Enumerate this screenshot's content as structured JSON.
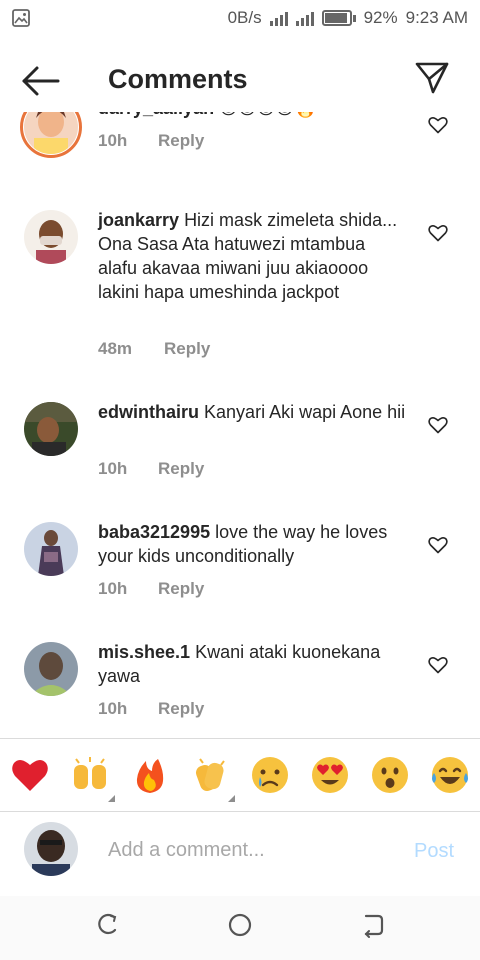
{
  "status_bar": {
    "data_rate": "0B/s",
    "battery": "92%",
    "battery_level": 0.92,
    "time": "9:23 AM"
  },
  "header": {
    "title": "Comments",
    "back_icon": "arrow-left-icon",
    "share_icon": "paper-plane-icon"
  },
  "comments": [
    {
      "username": "darry_aaliyah",
      "text": "",
      "emoji": "😍😍😍😍🔥",
      "time": "10h",
      "reply_label": "Reply",
      "avatar_colors": [
        "#f0b48a",
        "#fcd86b",
        "#f5d5c0"
      ]
    },
    {
      "username": "joankarry",
      "text": "Hizi mask zimeleta shida... Ona Sasa Ata hatuwezi mtambua alafu akavaa miwani juu akiaoooo lakini hapa umeshinda jackpot",
      "time": "48m",
      "reply_label": "Reply",
      "avatar_colors": [
        "#7a4b2e",
        "#e2d7cf",
        "#f4efe9"
      ]
    },
    {
      "username": "edwinthairu",
      "text": "Kanyari Aki wapi Aone hii",
      "time": "10h",
      "reply_label": "Reply",
      "avatar_colors": [
        "#3a4a2a",
        "#5b5b3f",
        "#2a2a2a"
      ]
    },
    {
      "username": "baba3212995",
      "text": "love the way he loves your kids unconditionally",
      "time": "10h",
      "reply_label": "Reply",
      "avatar_colors": [
        "#c9d3e3",
        "#4a3b58",
        "#8a6b86"
      ]
    },
    {
      "username": "mis.shee.1",
      "text": "Kwani ataki kuonekana yawa",
      "time": "10h",
      "reply_label": "Reply",
      "avatar_colors": [
        "#8c9aa8",
        "#a4c36b",
        "#5e4a3c"
      ]
    }
  ],
  "emoji_bar": [
    {
      "name": "red-heart-emoji",
      "glyph": "❤️"
    },
    {
      "name": "raising-hands-emoji",
      "glyph": "🙌"
    },
    {
      "name": "fire-emoji",
      "glyph": "🔥"
    },
    {
      "name": "clapping-hands-emoji",
      "glyph": "👏"
    },
    {
      "name": "crying-face-emoji",
      "glyph": "😢"
    },
    {
      "name": "heart-eyes-emoji",
      "glyph": "😍"
    },
    {
      "name": "surprised-face-emoji",
      "glyph": "😮"
    },
    {
      "name": "tears-of-joy-emoji",
      "glyph": "😂"
    }
  ],
  "composer": {
    "placeholder": "Add a comment...",
    "post_label": "Post"
  },
  "nav_bar": {
    "icons": [
      "recent-apps-icon",
      "home-icon",
      "back-icon"
    ]
  }
}
